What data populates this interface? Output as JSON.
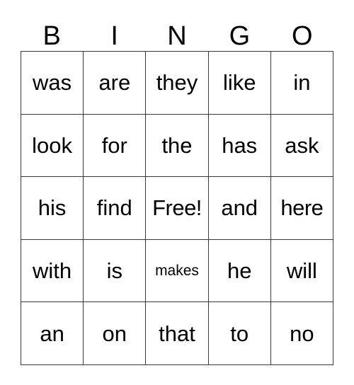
{
  "card": {
    "title": "BINGO",
    "header_letters": [
      "B",
      "I",
      "N",
      "G",
      "O"
    ],
    "free_space_label": "Free!",
    "free_space_position": {
      "row": 3,
      "column": 3
    },
    "grid_size": "5x5",
    "colors": {
      "background": "#ffffff",
      "text": "#000000",
      "border": "#3a3a3a"
    },
    "rows": [
      {
        "cells": [
          {
            "text": "was",
            "size": "normal"
          },
          {
            "text": "are",
            "size": "normal"
          },
          {
            "text": "they",
            "size": "normal"
          },
          {
            "text": "like",
            "size": "normal"
          },
          {
            "text": "in",
            "size": "normal"
          }
        ]
      },
      {
        "cells": [
          {
            "text": "look",
            "size": "normal"
          },
          {
            "text": "for",
            "size": "normal"
          },
          {
            "text": "the",
            "size": "normal"
          },
          {
            "text": "has",
            "size": "normal"
          },
          {
            "text": "ask",
            "size": "normal"
          }
        ]
      },
      {
        "cells": [
          {
            "text": "his",
            "size": "normal"
          },
          {
            "text": "find",
            "size": "normal"
          },
          {
            "text": "Free!",
            "size": "snug"
          },
          {
            "text": "and",
            "size": "normal"
          },
          {
            "text": "here",
            "size": "snug"
          }
        ]
      },
      {
        "cells": [
          {
            "text": "with",
            "size": "normal"
          },
          {
            "text": "is",
            "size": "normal"
          },
          {
            "text": "makes",
            "size": "small"
          },
          {
            "text": "he",
            "size": "normal"
          },
          {
            "text": "will",
            "size": "normal"
          }
        ]
      },
      {
        "cells": [
          {
            "text": "an",
            "size": "normal"
          },
          {
            "text": "on",
            "size": "normal"
          },
          {
            "text": "that",
            "size": "normal"
          },
          {
            "text": "to",
            "size": "normal"
          },
          {
            "text": "no",
            "size": "normal"
          }
        ]
      }
    ]
  }
}
